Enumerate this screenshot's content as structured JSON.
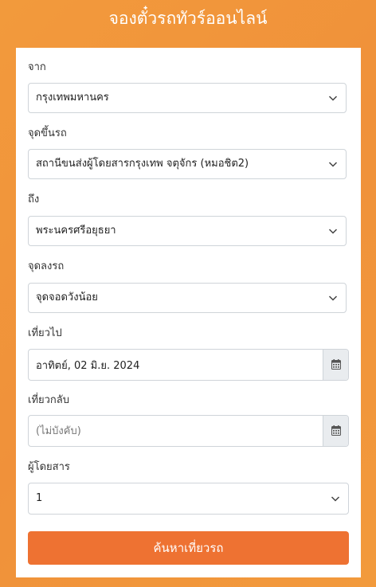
{
  "header": {
    "title": "จองตั๋วรถทัวร์ออนไลน์"
  },
  "form": {
    "from": {
      "label": "จาก",
      "value": "กรุงเทพมหานคร"
    },
    "boarding_point": {
      "label": "จุดขึ้นรถ",
      "value": "สถานีขนส่งผู้โดยสารกรุงเทพ จตุจักร (หมอชิต2)"
    },
    "to": {
      "label": "ถึง",
      "value": "พระนครศรีอยุธยา"
    },
    "dropoff_point": {
      "label": "จุดลงรถ",
      "value": "จุดจอดวังน้อย"
    },
    "departure": {
      "label": "เที่ยวไป",
      "value": "อาทิตย์, 02 มิ.ย. 2024",
      "icon": "calendar-icon"
    },
    "return": {
      "label": "เที่ยวกลับ",
      "value": "",
      "placeholder": "(ไม่บังคับ)",
      "icon": "calendar-icon"
    },
    "passengers": {
      "label": "ผู้โดยสาร",
      "value": "1"
    },
    "search_button": "ค้นหาเที่ยวรถ"
  },
  "colors": {
    "background": "#f29a3c",
    "button": "#ee7232",
    "addon": "#e9ecef"
  }
}
